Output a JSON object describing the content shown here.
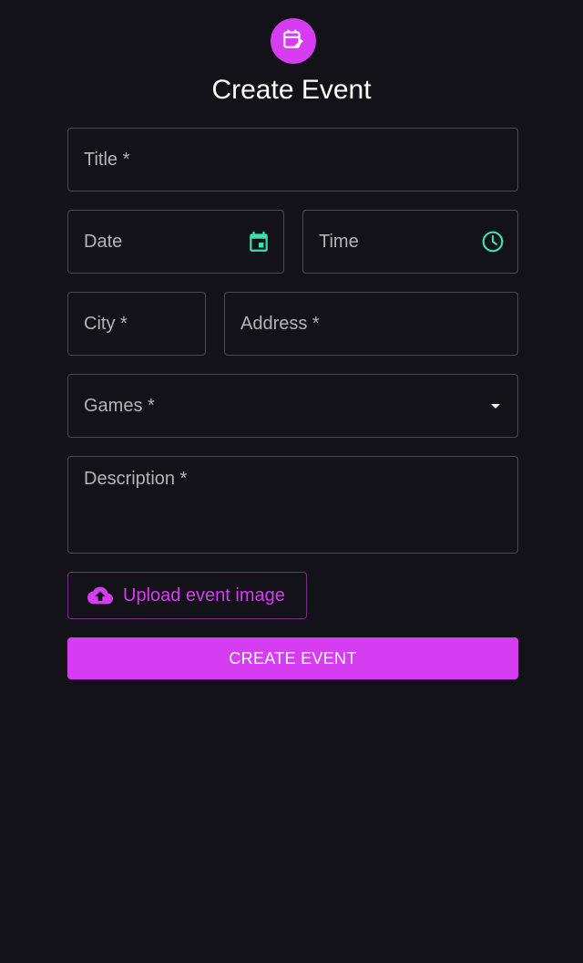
{
  "header": {
    "icon": "calendar-edit-icon",
    "title": "Create Event"
  },
  "form": {
    "title_label": "Title *",
    "date_label": "Date",
    "date_icon": "calendar-icon",
    "time_label": "Time",
    "time_icon": "clock-icon",
    "city_label": "City *",
    "address_label": "Address *",
    "games_label": "Games *",
    "games_icon": "dropdown-arrow-icon",
    "description_label": "Description *",
    "upload_label": "Upload event image",
    "upload_icon": "cloud-upload-icon",
    "submit_label": "CREATE EVENT"
  },
  "colors": {
    "background": "#131218",
    "accent": "#d63cf2",
    "adornment": "#3fe0b0",
    "field_border": "#4a4950",
    "label": "#b3b3b8"
  }
}
